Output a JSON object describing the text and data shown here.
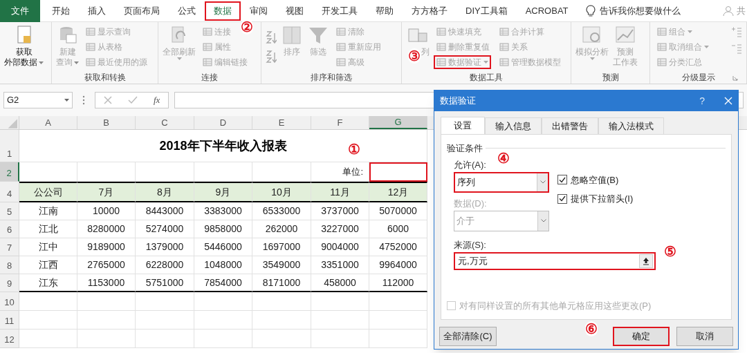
{
  "tabs": [
    {
      "label": "文件",
      "kind": "file",
      "selected": false,
      "highlighted": false
    },
    {
      "label": "开始",
      "kind": "tab",
      "selected": false,
      "highlighted": false
    },
    {
      "label": "插入",
      "kind": "tab",
      "selected": false,
      "highlighted": false
    },
    {
      "label": "页面布局",
      "kind": "tab",
      "selected": false,
      "highlighted": false
    },
    {
      "label": "公式",
      "kind": "tab",
      "selected": false,
      "highlighted": false
    },
    {
      "label": "数据",
      "kind": "tab",
      "selected": true,
      "highlighted": true
    },
    {
      "label": "审阅",
      "kind": "tab",
      "selected": false,
      "highlighted": false
    },
    {
      "label": "视图",
      "kind": "tab",
      "selected": false,
      "highlighted": false
    },
    {
      "label": "开发工具",
      "kind": "tab",
      "selected": false,
      "highlighted": false
    },
    {
      "label": "帮助",
      "kind": "tab",
      "selected": false,
      "highlighted": false
    },
    {
      "label": "方方格子",
      "kind": "tab",
      "selected": false,
      "highlighted": false
    },
    {
      "label": "DIY工具箱",
      "kind": "tab",
      "selected": false,
      "highlighted": false
    },
    {
      "label": "ACROBAT",
      "kind": "tab",
      "selected": false,
      "highlighted": false
    }
  ],
  "tell_me": "告诉我你想要做什么",
  "account": "共",
  "ribbon_groups": [
    {
      "items": [
        {
          "kind": "large",
          "lines": [
            "获取",
            "外部数据"
          ],
          "caret": true,
          "disabled": false
        }
      ]
    },
    {
      "label": "获取和转换",
      "items": [
        {
          "kind": "large",
          "lines": [
            "新建",
            "查询"
          ],
          "caret": true,
          "disabled": true
        },
        {
          "kind": "stack",
          "items": [
            {
              "label": "显示查询",
              "disabled": true
            },
            {
              "label": "从表格",
              "disabled": true
            },
            {
              "label": "最近使用的源",
              "disabled": true
            }
          ]
        }
      ]
    },
    {
      "label": "连接",
      "items": [
        {
          "kind": "large",
          "lines": [
            "全部刷新"
          ],
          "caret": true,
          "disabled": true
        },
        {
          "kind": "stack",
          "items": [
            {
              "label": "连接",
              "disabled": true
            },
            {
              "label": "属性",
              "disabled": true
            },
            {
              "label": "编辑链接",
              "disabled": true
            }
          ]
        }
      ]
    },
    {
      "label": "排序和筛选",
      "items": [
        {
          "kind": "sort",
          "disabled": true
        },
        {
          "kind": "large",
          "lines": [
            "排序"
          ],
          "disabled": true
        },
        {
          "kind": "large",
          "lines": [
            "筛选"
          ],
          "disabled": true
        },
        {
          "kind": "stack",
          "items": [
            {
              "label": "清除",
              "disabled": true
            },
            {
              "label": "重新应用",
              "disabled": true
            },
            {
              "label": "高级",
              "disabled": true
            }
          ]
        }
      ]
    },
    {
      "label": "数据工具",
      "items": [
        {
          "kind": "large",
          "lines": [
            "列"
          ],
          "disabled": true
        },
        {
          "kind": "stack",
          "items": [
            {
              "label": "快速填充",
              "disabled": true
            },
            {
              "label": "删除重复值",
              "disabled": true
            },
            {
              "label": "数据验证",
              "disabled": true,
              "caret": true,
              "highlighted": true
            }
          ]
        },
        {
          "kind": "stack",
          "items": [
            {
              "label": "合并计算",
              "disabled": true
            },
            {
              "label": "关系",
              "disabled": true
            },
            {
              "label": "管理数据模型",
              "disabled": true
            }
          ]
        }
      ]
    },
    {
      "label": "预测",
      "items": [
        {
          "kind": "large",
          "lines": [
            "模拟分析"
          ],
          "caret": true,
          "disabled": true
        },
        {
          "kind": "large",
          "lines": [
            "预测",
            "工作表"
          ],
          "disabled": true
        }
      ]
    },
    {
      "label": "分级显示",
      "items": [
        {
          "kind": "stack",
          "items": [
            {
              "label": "组合",
              "disabled": true,
              "caret": true
            },
            {
              "label": "取消组合",
              "disabled": true,
              "caret": true
            },
            {
              "label": "分类汇总",
              "disabled": true
            }
          ]
        },
        {
          "kind": "icons",
          "disabled": true
        }
      ]
    }
  ],
  "formula_bar": {
    "name_box": "G2",
    "function_label": "fx"
  },
  "sheet": {
    "columns": [
      {
        "label": "A",
        "selected": false
      },
      {
        "label": "B",
        "selected": false
      },
      {
        "label": "C",
        "selected": false
      },
      {
        "label": "D",
        "selected": false
      },
      {
        "label": "E",
        "selected": false
      },
      {
        "label": "F",
        "selected": false
      },
      {
        "label": "G",
        "selected": true
      }
    ],
    "rows": [
      {
        "number": "1",
        "kind": "title",
        "selected": false,
        "title": "2018年下半年收入报表"
      },
      {
        "number": "2",
        "kind": "unit",
        "selected": true,
        "label": "单位:",
        "highlighted": true
      },
      {
        "number": "4",
        "kind": "header",
        "selected": false,
        "cells": [
          "公公司",
          "7月",
          "8月",
          "9月",
          "10月",
          "11月",
          "12月"
        ]
      },
      {
        "number": "5",
        "kind": "data",
        "selected": false,
        "cells": [
          "江南",
          "10000",
          "8443000",
          "3383000",
          "6533000",
          "3737000",
          "5070000"
        ]
      },
      {
        "number": "6",
        "kind": "data",
        "selected": false,
        "cells": [
          "江北",
          "8280000",
          "5274000",
          "9858000",
          "262000",
          "3227000",
          "6000"
        ]
      },
      {
        "number": "7",
        "kind": "data",
        "selected": false,
        "cells": [
          "江中",
          "9189000",
          "1379000",
          "5446000",
          "1697000",
          "9004000",
          "4752000"
        ]
      },
      {
        "number": "8",
        "kind": "data",
        "selected": false,
        "cells": [
          "江西",
          "2765000",
          "6228000",
          "1048000",
          "3549000",
          "3351000",
          "9964000"
        ]
      },
      {
        "number": "9",
        "kind": "data",
        "selected": false,
        "cells": [
          "江东",
          "1153000",
          "5751000",
          "7854000",
          "8171000",
          "458000",
          "112000"
        ]
      },
      {
        "number": "10",
        "kind": "empty",
        "selected": false
      },
      {
        "number": "11",
        "kind": "empty",
        "selected": false
      },
      {
        "number": "12",
        "kind": "empty",
        "selected": false
      }
    ]
  },
  "dialog": {
    "title": "数据验证",
    "help": "?",
    "tabs": [
      {
        "label": "设置",
        "selected": true
      },
      {
        "label": "输入信息",
        "selected": false
      },
      {
        "label": "出错警告",
        "selected": false
      },
      {
        "label": "输入法模式",
        "selected": false
      }
    ],
    "section": "验证条件",
    "allow": {
      "label": "允许(A):",
      "value": "序列",
      "highlighted": true
    },
    "options": [
      {
        "label": "忽略空值(B)",
        "checked": true
      },
      {
        "label": "提供下拉箭头(I)",
        "checked": true
      }
    ],
    "data": {
      "label": "数据(D):",
      "value": "介于",
      "disabled": true
    },
    "source": {
      "label": "来源(S):",
      "value": "元,万元",
      "highlighted": true
    },
    "apply_all": {
      "label": "对有同样设置的所有其他单元格应用这些更改(P)",
      "checked": false,
      "disabled": true
    },
    "buttons": [
      {
        "label": "全部清除(C)",
        "kind": "clear",
        "highlighted": false
      },
      {
        "label": "确定",
        "kind": "ok",
        "highlighted": true
      },
      {
        "label": "取消",
        "kind": "cancel",
        "highlighted": false
      }
    ]
  },
  "annotations": [
    {
      "label": "①"
    },
    {
      "label": "②"
    },
    {
      "label": "③"
    },
    {
      "label": "④"
    },
    {
      "label": "⑤"
    },
    {
      "label": "⑥"
    }
  ]
}
